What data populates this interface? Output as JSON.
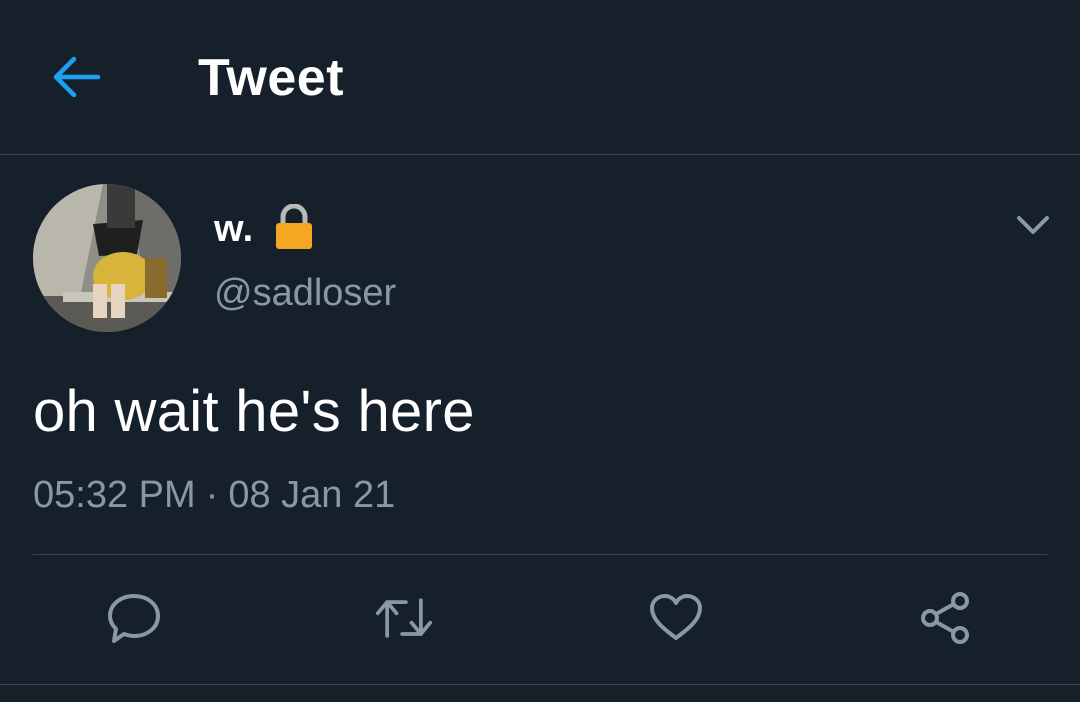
{
  "header": {
    "title": "Tweet",
    "back_icon": "arrow-left-icon"
  },
  "tweet": {
    "display_name": "w.",
    "protected_icon": "lock-icon",
    "handle": "@sadloser",
    "text": "oh wait he's here",
    "time": "05:32 PM",
    "separator": "·",
    "date": "08 Jan 21"
  },
  "actions": {
    "reply_icon": "reply-icon",
    "retweet_icon": "retweet-icon",
    "like_icon": "heart-icon",
    "share_icon": "share-icon"
  },
  "colors": {
    "background": "#15202b",
    "accent": "#1da1f2",
    "secondary_text": "#8899a6",
    "divider": "#38444d",
    "lock": "#f5a623"
  }
}
